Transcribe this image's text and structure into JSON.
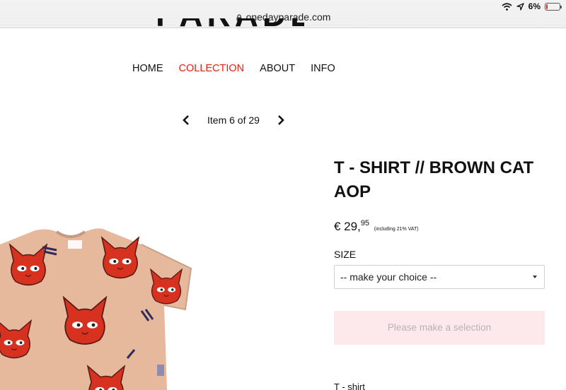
{
  "browser": {
    "url": "onedayparade.com",
    "battery": "6%",
    "icons": [
      "lock-icon",
      "wifi-icon",
      "location-arrow-icon",
      "battery-icon"
    ]
  },
  "nav": {
    "items": [
      {
        "label": "HOME",
        "active": false
      },
      {
        "label": "COLLECTION",
        "active": true
      },
      {
        "label": "ABOUT",
        "active": false
      },
      {
        "label": "INFO",
        "active": false
      }
    ],
    "active_color": "#e8200e"
  },
  "pager": {
    "text": "Item 6 of 29"
  },
  "product": {
    "title": "T - SHIRT // BROWN CAT AOP",
    "price_main": "€ 29,",
    "price_cents": "95",
    "price_vat": "(including 21% VAT)",
    "size_label": "SIZE",
    "size_select_value": "-- make your choice --",
    "add_button": "Please make a selection",
    "description_start": "T - shirt"
  }
}
